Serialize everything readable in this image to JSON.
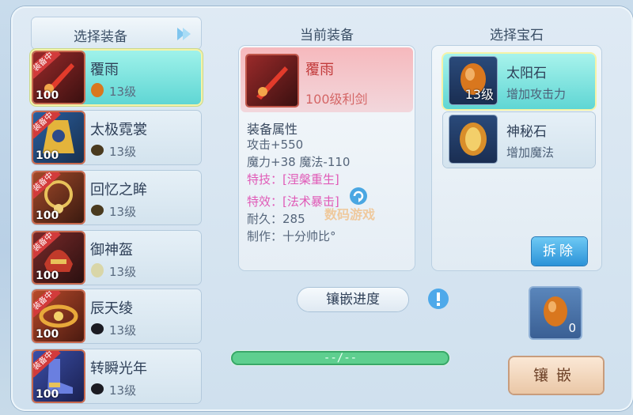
{
  "left": {
    "title": "选择装备",
    "items": [
      {
        "name": "覆雨",
        "gem_level": "13级",
        "level": "100",
        "badge": "装备中"
      },
      {
        "name": "太极霓裳",
        "gem_level": "13级",
        "level": "100",
        "badge": "装备中"
      },
      {
        "name": "回忆之眸",
        "gem_level": "13级",
        "level": "100",
        "badge": "装备中"
      },
      {
        "name": "御神盔",
        "gem_level": "13级",
        "level": "100",
        "badge": "装备中"
      },
      {
        "name": "辰天绫",
        "gem_level": "13级",
        "level": "100",
        "badge": "装备中"
      },
      {
        "name": "转瞬光年",
        "gem_level": "13级",
        "level": "100",
        "badge": "装备中"
      }
    ]
  },
  "middle": {
    "title": "当前装备",
    "equip_name": "覆雨",
    "equip_sub": "100级利剑",
    "attr_head": "装备属性",
    "attrs": [
      "攻击+550",
      "魔力+38 魔法-110"
    ],
    "skill": "特技：[涅槃重生]",
    "effect": "特效：[法术暴击]",
    "durability": "耐久：285",
    "maker": "制作：十分帅比°",
    "watermark": "数码游戏",
    "progress_label": "镶嵌进度",
    "progress_text": "--/--"
  },
  "right": {
    "title": "选择宝石",
    "gems": [
      {
        "name": "太阳石",
        "desc": "增加攻击力",
        "level": "13级"
      },
      {
        "name": "神秘石",
        "desc": "增加魔法"
      }
    ],
    "remove_button": "拆除",
    "slot_count": "0",
    "inlay_button": "镶嵌"
  }
}
